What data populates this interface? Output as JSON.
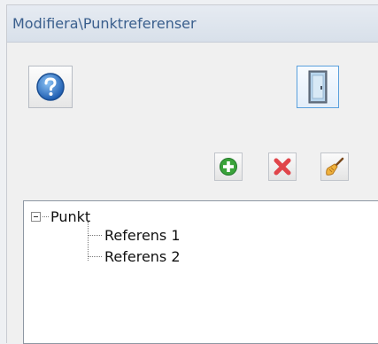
{
  "window": {
    "title": "Modifiera\\Punktreferenser"
  },
  "toolbar": {
    "help_icon": "help-icon",
    "exit_icon": "door-exit-icon",
    "add_icon": "plus-icon",
    "delete_icon": "x-delete-icon",
    "clear_icon": "broom-icon"
  },
  "tree": {
    "root": {
      "label": "Punkt",
      "expanded": true
    },
    "children": [
      {
        "label": "Referens 1"
      },
      {
        "label": "Referens 2"
      }
    ]
  },
  "colors": {
    "title_text": "#3a5f8d",
    "add_green": "#3aa33a",
    "delete_red": "#e0454a",
    "help_blue": "#2e6fc0"
  }
}
